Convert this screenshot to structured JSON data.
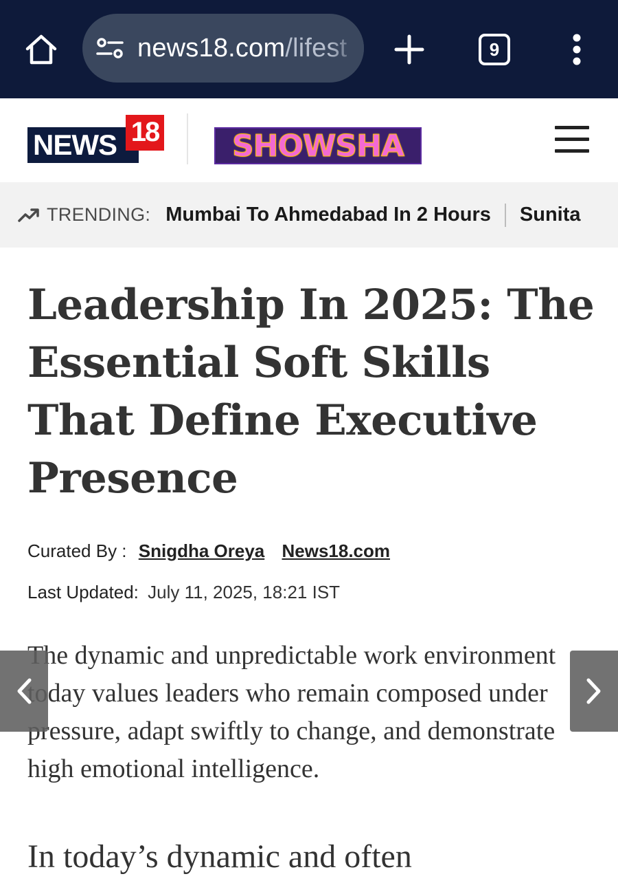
{
  "browser": {
    "url_host": "news18.com",
    "url_path": "/lifest",
    "tab_count": "9",
    "icons": [
      "home-icon",
      "site-settings-icon",
      "new-tab-plus-icon",
      "tab-switcher-icon",
      "overflow-menu-icon"
    ]
  },
  "header": {
    "logo_news": "NEWS",
    "logo_18": "18",
    "showsha_logo": "SHOWSHA",
    "colors": {
      "news_navy": "#0d1b3e",
      "news_red": "#e3171b",
      "showsha_purple": "#3a1f6b",
      "showsha_pink": "#f36ad3"
    }
  },
  "trending": {
    "label": "TRENDING:",
    "items": [
      "Mumbai To Ahmedabad In 2 Hours",
      "Sunita"
    ]
  },
  "article": {
    "headline": "Leadership In 2025: The Essential Soft Skills That Define Executive Presence",
    "curated_label": "Curated By :",
    "author": "Snigdha Oreya",
    "source": "News18.com",
    "updated_label": "Last Updated:",
    "updated_value": "July 11, 2025, 18:21 IST",
    "summary": "The dynamic and unpredictable work environment today values leaders who remain composed under pressure, adapt swiftly to change, and demonstrate high emotional intelligence.",
    "body_start": "In today’s dynamic and often"
  }
}
